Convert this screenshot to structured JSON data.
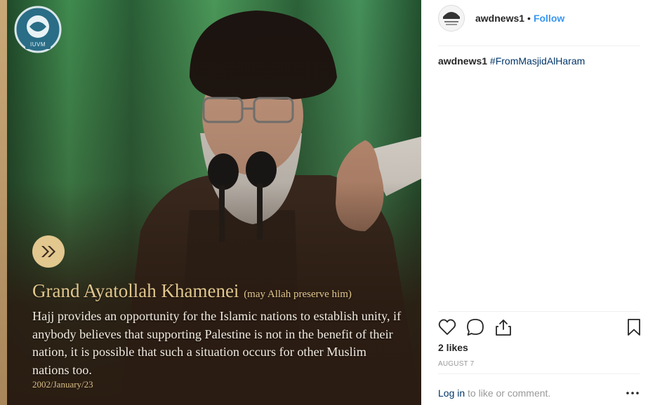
{
  "media": {
    "logo_text": "IUVM",
    "quote_title": "Grand Ayatollah Khamenei",
    "quote_subtitle": "(may Allah preserve him)",
    "quote_body": "Hajj provides an opportunity for the Islamic nations to establish unity, if anybody believes that supporting Palestine is not in the benefit of their nation, it is possible that such a situation occurs for other Muslim nations too.",
    "quote_date": "2002/January/23",
    "colors": {
      "accent_gold": "#e2c78e",
      "bg_green": "#2f6a3c",
      "bg_brown": "#3a2a1e"
    }
  },
  "header": {
    "username": "awdnews1",
    "separator": "•",
    "follow_label": "Follow",
    "avatar_icon": "news-logo-icon"
  },
  "caption": {
    "username": "awdnews1",
    "hashtag": "#FromMasjidAlHaram"
  },
  "actions": {
    "icons": [
      "heart-icon",
      "comment-icon",
      "share-icon",
      "bookmark-icon"
    ]
  },
  "likes": "2 likes",
  "post_date": "AUGUST 7",
  "footer": {
    "login_label": "Log in",
    "login_suffix": " to like or comment.",
    "more_icon": "more-options-icon"
  },
  "colors": {
    "link_blue": "#3897f0",
    "hashtag_blue": "#003569",
    "muted": "#999999"
  }
}
